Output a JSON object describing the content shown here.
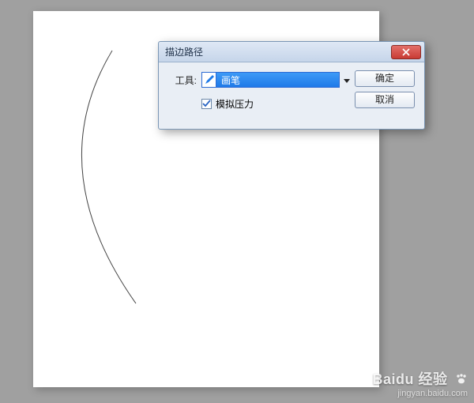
{
  "dialog": {
    "title": "描边路径",
    "tool_label": "工具:",
    "tool_selected": "画笔",
    "simulate_pressure_label": "模拟压力",
    "simulate_pressure_checked": true,
    "buttons": {
      "ok": "确定",
      "cancel": "取消"
    }
  },
  "watermark": {
    "brand": "Baidu 经验",
    "url": "jingyan.baidu.com"
  }
}
